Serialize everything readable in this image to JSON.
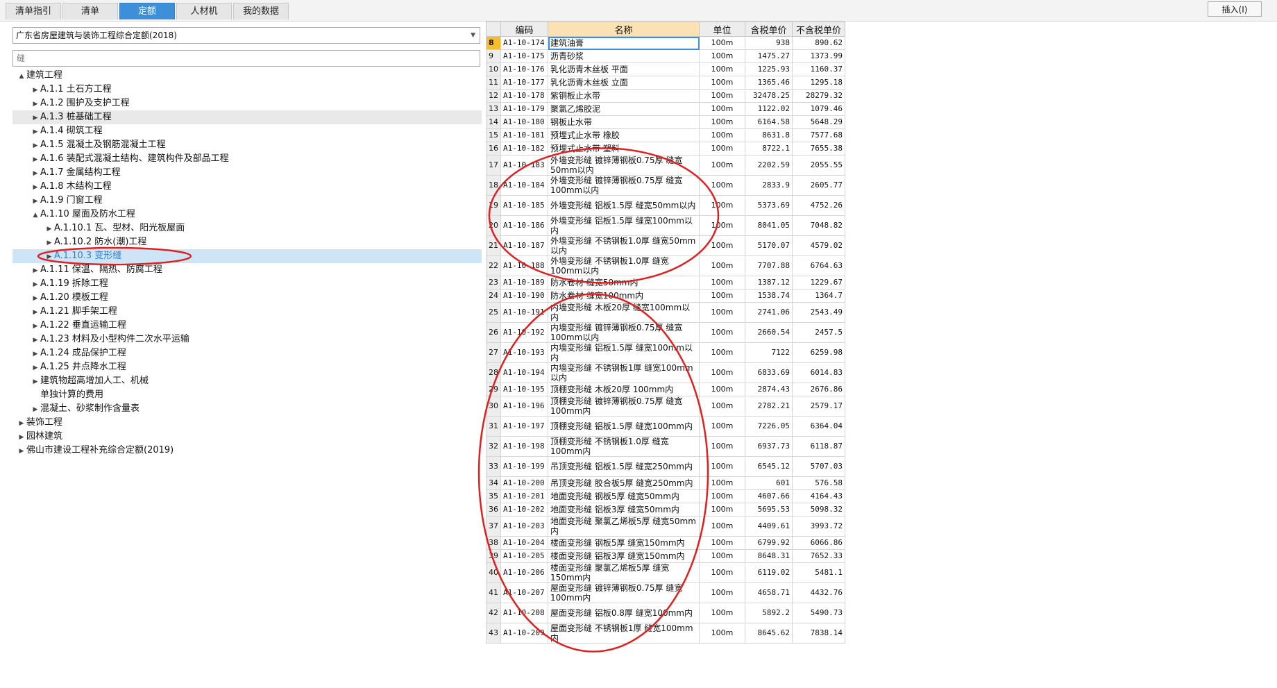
{
  "tabs": [
    {
      "label": "清单指引",
      "active": false
    },
    {
      "label": "清单",
      "active": false
    },
    {
      "label": "定额",
      "active": true
    },
    {
      "label": "人材机",
      "active": false
    },
    {
      "label": "我的数据",
      "active": false
    }
  ],
  "insert_button": "插入(I)",
  "library_select": "广东省房屋建筑与装饰工程综合定额(2018)",
  "search_value": "缝",
  "tree": [
    {
      "label": "建筑工程",
      "level": 0,
      "toggle": "▲",
      "state": ""
    },
    {
      "label": "A.1.1 土石方工程",
      "level": 1,
      "toggle": "▶",
      "state": ""
    },
    {
      "label": "A.1.2 围护及支护工程",
      "level": 1,
      "toggle": "▶",
      "state": ""
    },
    {
      "label": "A.1.3 桩基础工程",
      "level": 1,
      "toggle": "▶",
      "state": "gray"
    },
    {
      "label": "A.1.4 砌筑工程",
      "level": 1,
      "toggle": "▶",
      "state": ""
    },
    {
      "label": "A.1.5 混凝土及钢筋混凝土工程",
      "level": 1,
      "toggle": "▶",
      "state": ""
    },
    {
      "label": "A.1.6 装配式混凝土结构、建筑构件及部品工程",
      "level": 1,
      "toggle": "▶",
      "state": ""
    },
    {
      "label": "A.1.7 金属结构工程",
      "level": 1,
      "toggle": "▶",
      "state": ""
    },
    {
      "label": "A.1.8 木结构工程",
      "level": 1,
      "toggle": "▶",
      "state": ""
    },
    {
      "label": "A.1.9 门窗工程",
      "level": 1,
      "toggle": "▶",
      "state": ""
    },
    {
      "label": "A.1.10 屋面及防水工程",
      "level": 1,
      "toggle": "▲",
      "state": ""
    },
    {
      "label": "A.1.10.1 瓦、型材、阳光板屋面",
      "level": 2,
      "toggle": "▶",
      "state": ""
    },
    {
      "label": "A.1.10.2 防水(潮)工程",
      "level": 2,
      "toggle": "▶",
      "state": ""
    },
    {
      "label": "A.1.10.3 变形缝",
      "level": 2,
      "toggle": "▶",
      "state": "blue"
    },
    {
      "label": "A.1.11 保温、隔热、防腐工程",
      "level": 1,
      "toggle": "▶",
      "state": ""
    },
    {
      "label": "A.1.19 拆除工程",
      "level": 1,
      "toggle": "▶",
      "state": ""
    },
    {
      "label": "A.1.20 模板工程",
      "level": 1,
      "toggle": "▶",
      "state": ""
    },
    {
      "label": "A.1.21 脚手架工程",
      "level": 1,
      "toggle": "▶",
      "state": ""
    },
    {
      "label": "A.1.22 垂直运输工程",
      "level": 1,
      "toggle": "▶",
      "state": ""
    },
    {
      "label": "A.1.23 材料及小型构件二次水平运输",
      "level": 1,
      "toggle": "▶",
      "state": ""
    },
    {
      "label": "A.1.24 成品保护工程",
      "level": 1,
      "toggle": "▶",
      "state": ""
    },
    {
      "label": "A.1.25 井点降水工程",
      "level": 1,
      "toggle": "▶",
      "state": ""
    },
    {
      "label": "建筑物超高增加人工、机械",
      "level": 1,
      "toggle": "▶",
      "state": ""
    },
    {
      "label": "单独计算的费用",
      "level": 1,
      "toggle": "",
      "state": ""
    },
    {
      "label": "混凝土、砂浆制作含量表",
      "level": 1,
      "toggle": "▶",
      "state": ""
    },
    {
      "label": "装饰工程",
      "level": 0,
      "toggle": "▶",
      "state": ""
    },
    {
      "label": "园林建筑",
      "level": 0,
      "toggle": "▶",
      "state": ""
    },
    {
      "label": "佛山市建设工程补充综合定额(2019)",
      "level": 0,
      "toggle": "▶",
      "state": ""
    }
  ],
  "table": {
    "headers": [
      "",
      "编码",
      "名称",
      "单位",
      "含税单价",
      "不含税单价"
    ],
    "rows": [
      [
        "8",
        "A1-10-174",
        "建筑油膏",
        "100m",
        "938",
        "890.62"
      ],
      [
        "9",
        "A1-10-175",
        "沥青砂浆",
        "100m",
        "1475.27",
        "1373.99"
      ],
      [
        "10",
        "A1-10-176",
        "乳化沥青木丝板 平面",
        "100m",
        "1225.93",
        "1160.37"
      ],
      [
        "11",
        "A1-10-177",
        "乳化沥青木丝板 立面",
        "100m",
        "1365.46",
        "1295.18"
      ],
      [
        "12",
        "A1-10-178",
        "紫铜板止水带",
        "100m",
        "32478.25",
        "28279.32"
      ],
      [
        "13",
        "A1-10-179",
        "聚氯乙烯胶泥",
        "100m",
        "1122.02",
        "1079.46"
      ],
      [
        "14",
        "A1-10-180",
        "钢板止水带",
        "100m",
        "6164.58",
        "5648.29"
      ],
      [
        "15",
        "A1-10-181",
        "预埋式止水带 橡胶",
        "100m",
        "8631.8",
        "7577.68"
      ],
      [
        "16",
        "A1-10-182",
        "预埋式止水带 塑料",
        "100m",
        "8722.1",
        "7655.38"
      ],
      [
        "17",
        "A1-10-183",
        "外墙变形缝 镀锌薄钢板0.75厚 缝宽50mm以内",
        "100m",
        "2202.59",
        "2055.55"
      ],
      [
        "18",
        "A1-10-184",
        "外墙变形缝 镀锌薄钢板0.75厚 缝宽100mm以内",
        "100m",
        "2833.9",
        "2605.77"
      ],
      [
        "19",
        "A1-10-185",
        "外墙变形缝 铝板1.5厚 缝宽50mm以内",
        "100m",
        "5373.69",
        "4752.26"
      ],
      [
        "20",
        "A1-10-186",
        "外墙变形缝 铝板1.5厚 缝宽100mm以内",
        "100m",
        "8041.05",
        "7048.82"
      ],
      [
        "21",
        "A1-10-187",
        "外墙变形缝 不锈钢板1.0厚 缝宽50mm以内",
        "100m",
        "5170.07",
        "4579.02"
      ],
      [
        "22",
        "A1-10-188",
        "外墙变形缝 不锈钢板1.0厚 缝宽100mm以内",
        "100m",
        "7707.88",
        "6764.63"
      ],
      [
        "23",
        "A1-10-189",
        "防水卷材 缝宽50mm内",
        "100m",
        "1387.12",
        "1229.67"
      ],
      [
        "24",
        "A1-10-190",
        "防水卷材 缝宽100mm内",
        "100m",
        "1538.74",
        "1364.7"
      ],
      [
        "25",
        "A1-10-191",
        "内墙变形缝 木板20厚 缝宽100mm以内",
        "100m",
        "2741.06",
        "2543.49"
      ],
      [
        "26",
        "A1-10-192",
        "内墙变形缝 镀锌薄钢板0.75厚 缝宽100mm以内",
        "100m",
        "2660.54",
        "2457.5"
      ],
      [
        "27",
        "A1-10-193",
        "内墙变形缝 铝板1.5厚 缝宽100mm以内",
        "100m",
        "7122",
        "6259.98"
      ],
      [
        "28",
        "A1-10-194",
        "内墙变形缝 不锈钢板1厚 缝宽100mm以内",
        "100m",
        "6833.69",
        "6014.83"
      ],
      [
        "29",
        "A1-10-195",
        "顶棚变形缝 木板20厚 100mm内",
        "100m",
        "2874.43",
        "2676.86"
      ],
      [
        "30",
        "A1-10-196",
        "顶棚变形缝 镀锌薄钢板0.75厚 缝宽100mm内",
        "100m",
        "2782.21",
        "2579.17"
      ],
      [
        "31",
        "A1-10-197",
        "顶棚变形缝 铝板1.5厚 缝宽100mm内",
        "100m",
        "7226.05",
        "6364.04"
      ],
      [
        "32",
        "A1-10-198",
        "顶棚变形缝 不锈钢板1.0厚 缝宽100mm内",
        "100m",
        "6937.73",
        "6118.87"
      ],
      [
        "33",
        "A1-10-199",
        "吊顶变形缝 铝板1.5厚 缝宽250mm内",
        "100m",
        "6545.12",
        "5707.03"
      ],
      [
        "34",
        "A1-10-200",
        "吊顶变形缝 胶合板5厚 缝宽250mm内",
        "100m",
        "601",
        "576.58"
      ],
      [
        "35",
        "A1-10-201",
        "地面变形缝 钢板5厚 缝宽50mm内",
        "100m",
        "4607.66",
        "4164.43"
      ],
      [
        "36",
        "A1-10-202",
        "地面变形缝 铝板3厚 缝宽50mm内",
        "100m",
        "5695.53",
        "5098.32"
      ],
      [
        "37",
        "A1-10-203",
        "地面变形缝 聚氯乙烯板5厚 缝宽50mm内",
        "100m",
        "4409.61",
        "3993.72"
      ],
      [
        "38",
        "A1-10-204",
        "楼面变形缝 钢板5厚 缝宽150mm内",
        "100m",
        "6799.92",
        "6066.86"
      ],
      [
        "39",
        "A1-10-205",
        "楼面变形缝 铝板3厚 缝宽150mm内",
        "100m",
        "8648.31",
        "7652.33"
      ],
      [
        "40",
        "A1-10-206",
        "楼面变形缝 聚氯乙烯板5厚 缝宽150mm内",
        "100m",
        "6119.02",
        "5481.1"
      ],
      [
        "41",
        "A1-10-207",
        "屋面变形缝 镀锌薄钢板0.75厚 缝宽100mm内",
        "100m",
        "4658.71",
        "4432.76"
      ],
      [
        "42",
        "A1-10-208",
        "屋面变形缝 铝板0.8厚 缝宽100mm内",
        "100m",
        "5892.2",
        "5490.73"
      ],
      [
        "43",
        "A1-10-209",
        "屋面变形缝 不锈钢板1厚 缝宽100mm内",
        "100m",
        "8645.62",
        "7838.14"
      ]
    ]
  },
  "annotation_color": "#e02020"
}
